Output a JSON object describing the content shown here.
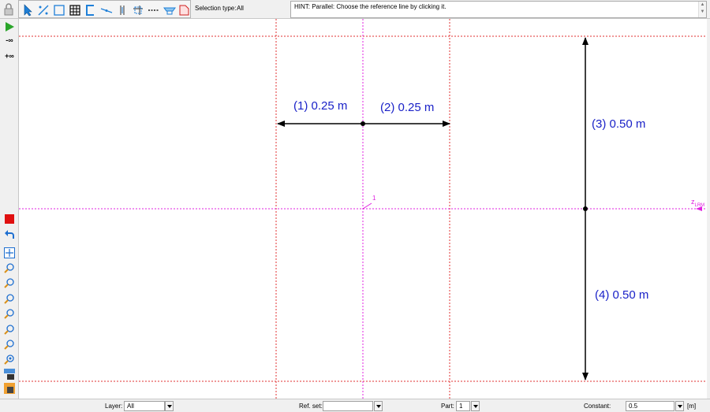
{
  "toolbar": {
    "selection_type_label": "Selection type:",
    "selection_type_value": "All",
    "hint_text": "HINT: Parallel: Choose the reference line by clicking it."
  },
  "left_toolbar": {
    "minus_inf": "-∞",
    "plus_inf": "+∞"
  },
  "canvas": {
    "dimensions": {
      "d1": "(1) 0.25 m",
      "d2": "(2) 0.25 m",
      "d3": "(3) 0.50 m",
      "d4": "(4) 0.50 m"
    },
    "member_label": "1",
    "axis_label": "z",
    "axis_label_sub": "LRM"
  },
  "bottom_bar": {
    "layer_label": "Layer:",
    "layer_value": "All",
    "ref_set_label": "Ref. set:",
    "ref_set_value": "",
    "part_label": "Part:",
    "part_value": "1",
    "constant_label": "Constant:",
    "constant_value": "0.5",
    "unit": "[m]"
  },
  "colors": {
    "dimension_text": "#1a22c8",
    "guide_red": "#e03030",
    "guide_magenta": "#e020e0",
    "play_green": "#2aa52a",
    "stop_red": "#e01010"
  }
}
